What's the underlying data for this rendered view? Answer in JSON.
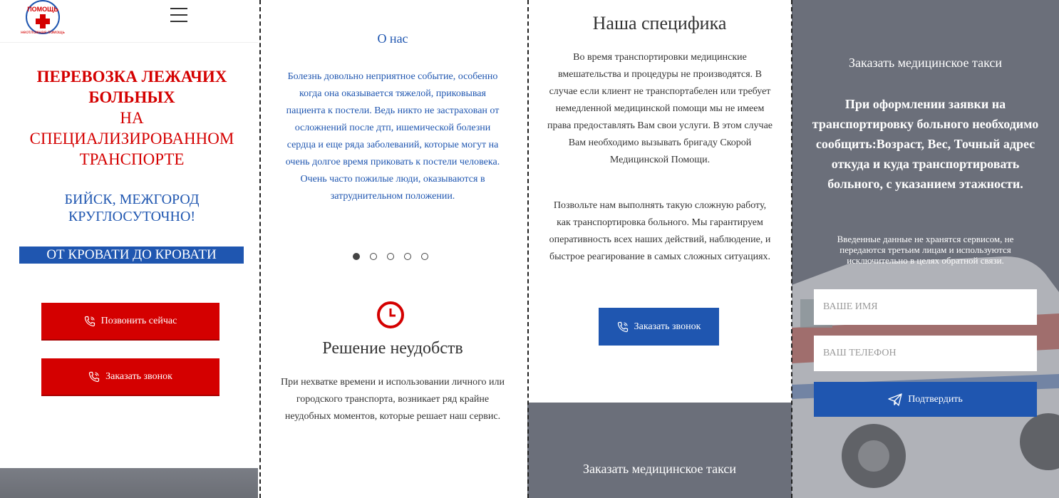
{
  "logo": {
    "text_top": "ПОМОЩЬ",
    "text_bottom": "неотложная помощь"
  },
  "hero": {
    "line1": "ПЕРЕВОЗКА ЛЕЖАЧИХ",
    "line2": "БОЛЬНЫХ",
    "line3": "НА",
    "line4": "СПЕЦИАЛИЗИРОВАННОМ",
    "line5": "ТРАНСПОРТЕ",
    "sub1": "БИЙСК, МЕЖГОРОД",
    "sub2": "КРУГЛОСУТОЧНО!",
    "banner": "ОТ КРОВАТИ ДО КРОВАТИ",
    "call_now": "Позвонить сейчас",
    "order_call": "Заказать звонок"
  },
  "about": {
    "title": "О нас",
    "text": "Болезнь довольно неприятное событие, особенно когда она оказывается тяжелой, приковывая пациента к постели. Ведь никто не застрахован от осложнений после дтп, ишемической болезни сердца и еще ряда заболеваний, которые могут на очень долгое время приковать к постели человека. Очень часто пожилые люди, оказываются в затруднительном положении.",
    "slides": 5,
    "active_slide": 1
  },
  "solution": {
    "title": "Решение неудобств",
    "text": "При нехватке времени и использовании личного или городского транспорта, возникает ряд крайне неудобных моментов, которые решает наш сервис."
  },
  "specifics": {
    "title": "Наша специфика",
    "p1": "Во время транспортировки медицинские вмешательства и процедуры не производятся. В случае если клиент не транспортабелен или требует немедленной медицинской помощи мы не имеем права предоставлять Вам свои услуги. В этом случае Вам необходимо вызывать бригаду Скорой Медицинской Помощи.",
    "p2": "Позвольте нам выполнять такую сложную работу, как транспортировка больного. Мы гарантируем оперативность всех наших действий, наблюдение, и быстрое реагирование в самых сложных ситуациях.",
    "order_call": "Заказать звонок",
    "taxi_title": "Заказать медицинское такси"
  },
  "form": {
    "title": "Заказать медицинское такси",
    "instructions": "При оформлении заявки на транспортировку больного необходимо сообщить:Возраст, Вес, Точный адрес откуда и куда транспортировать больного, с указанием этажности.",
    "note": "Введенные данные не хранятся сервисом, не передаются третьим лицам и используются исключительно в целях обратной связи.",
    "name_placeholder": "ВАШЕ ИМЯ",
    "phone_placeholder": "ВАШ ТЕЛЕФОН",
    "submit": "Подтвердить"
  },
  "colors": {
    "red": "#d40000",
    "blue": "#1f56b0",
    "gray": "#6b6f7a"
  }
}
